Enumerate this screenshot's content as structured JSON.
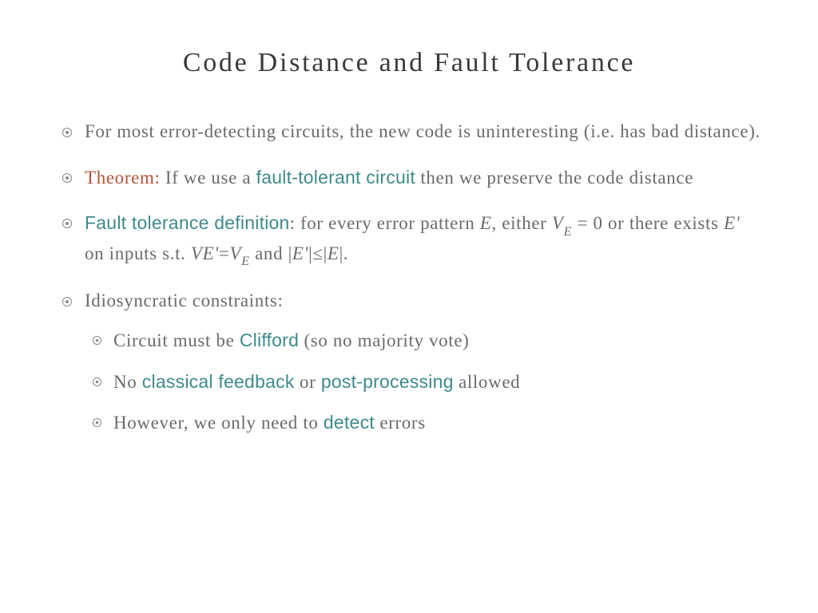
{
  "title": "Code Distance and Fault Tolerance",
  "b1": "For most error-detecting circuits, the new code is uninteresting (i.e. has bad distance).",
  "b2": {
    "theorem": "Theorem:",
    "t1": " If we use a ",
    "teal": "fault-tolerant circuit",
    "t2": " then we preserve the code distance"
  },
  "b3": {
    "teal": "Fault tolerance definition",
    "t1": ": for every error pattern ",
    "E": "E",
    "t2": ", either ",
    "VE": "V",
    "VEsub": "E",
    "t3": " = 0 or there exists ",
    "Eprime": "E'",
    "t4": " on inputs s.t. ",
    "VEp": "VE'",
    "eq": "=",
    "VE2": "V",
    "VE2sub": "E",
    "t5": " and |",
    "Ep2": "E'",
    "t6": "|≤|",
    "E2": "E",
    "t7": "|."
  },
  "b4": "Idiosyncratic constraints:",
  "s1": {
    "t1": "Circuit must be ",
    "teal": "Clifford",
    "t2": " (so no majority vote)"
  },
  "s2": {
    "t1": "No ",
    "teal1": "classical feedback",
    "t2": " or ",
    "teal2": "post-processing",
    "t3": " allowed"
  },
  "s3": {
    "t1": "However, we only need to ",
    "teal": "detect",
    "t2": " errors"
  }
}
